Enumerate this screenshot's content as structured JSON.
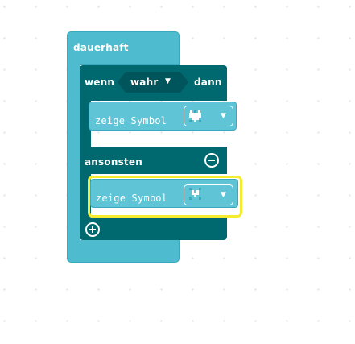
{
  "forever_block": {
    "label": "dauerhaft"
  },
  "if_block": {
    "if_label": "wenn",
    "condition_value": "wahr",
    "condition_arrow": "▼",
    "then_label": "dann",
    "else_label": "ansonsten",
    "remove_else_icon": "minus-circle-icon",
    "add_branch_icon": "plus-circle-icon"
  },
  "then_action": {
    "label": "zeige Symbol",
    "icon": "heart-icon",
    "arrow": "▼"
  },
  "else_action": {
    "label": "zeige Symbol",
    "icon": "small-heart-icon",
    "arrow": "▼",
    "selected": true
  },
  "colors": {
    "basic": "#4ebbcf",
    "logic": "#006970",
    "selection": "#f4ec2c"
  }
}
